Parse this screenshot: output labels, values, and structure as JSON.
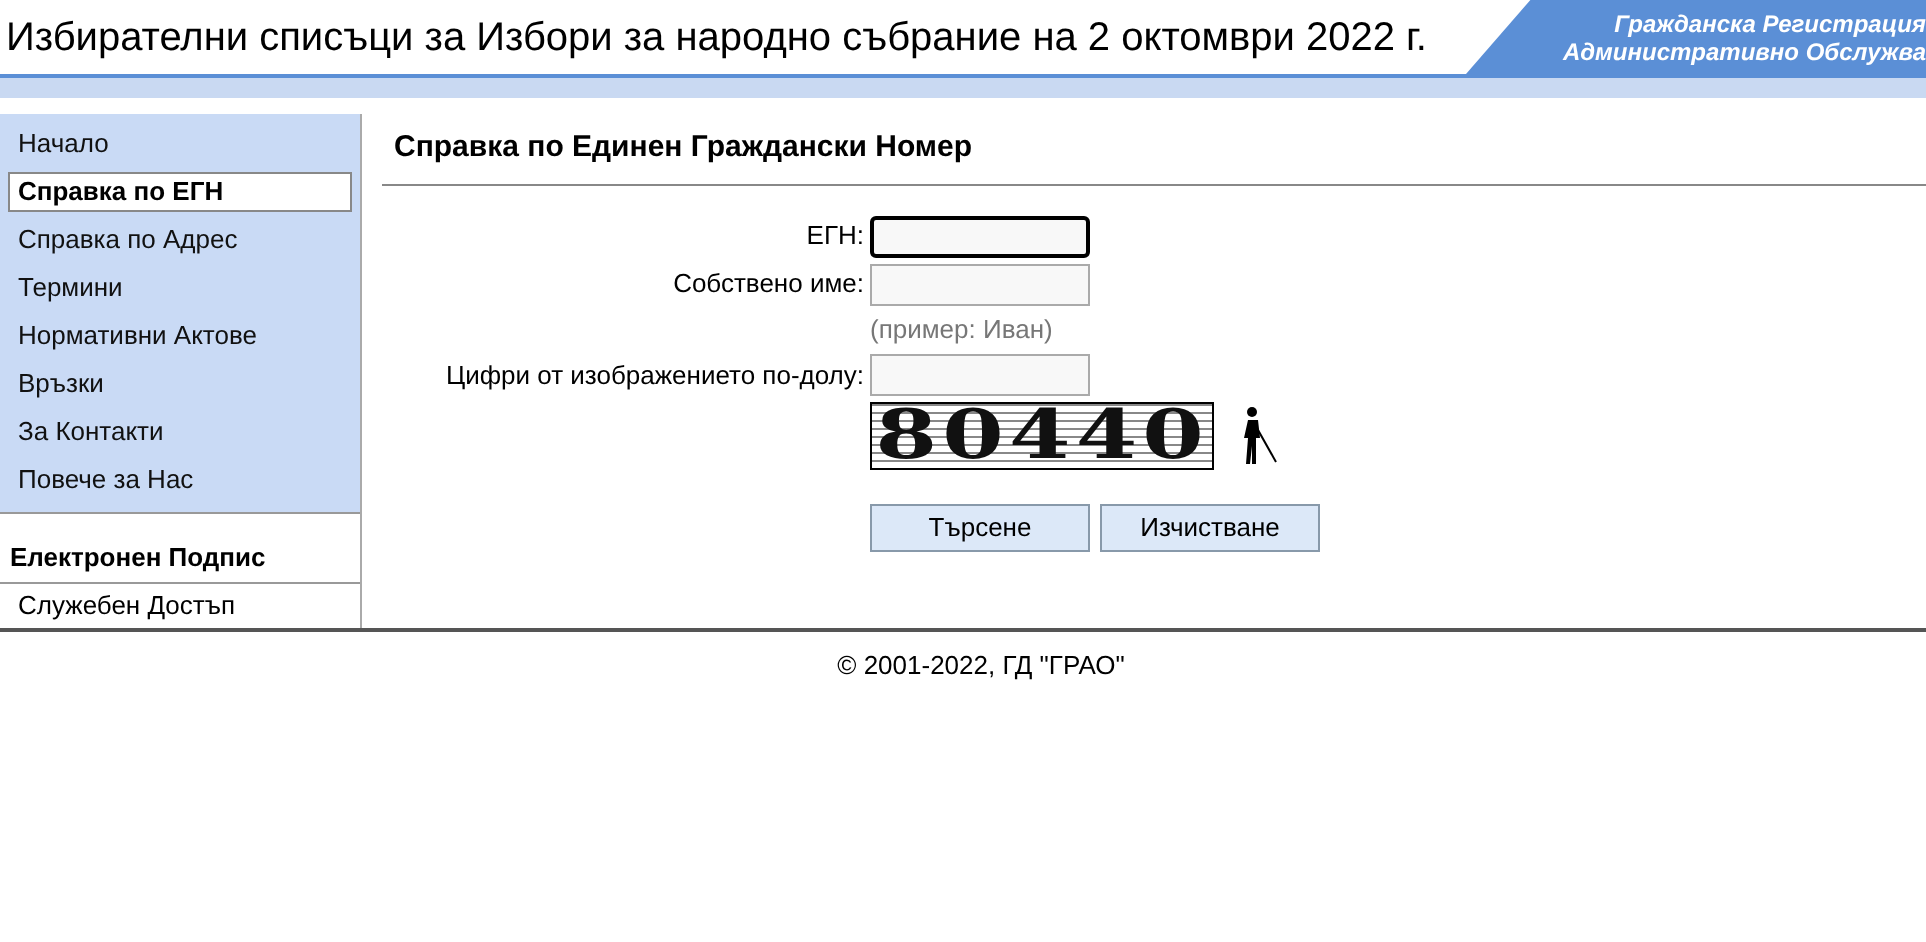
{
  "header": {
    "title": "Избирателни списъци за Избори за народно събрание на 2 октомври 2022 г.",
    "banner_lines": [
      "Гражданска Регистрация",
      "Административно Обслужва"
    ]
  },
  "sidebar": {
    "items": [
      {
        "label": "Начало",
        "selected": false
      },
      {
        "label": "Справка по ЕГН",
        "selected": true
      },
      {
        "label": "Справка по Адрес",
        "selected": false
      },
      {
        "label": "Термини",
        "selected": false
      },
      {
        "label": "Нормативни Актове",
        "selected": false
      },
      {
        "label": "Връзки",
        "selected": false
      },
      {
        "label": "За Контакти",
        "selected": false
      },
      {
        "label": "Повече за Нас",
        "selected": false
      }
    ],
    "section_title": "Електронен Подпис",
    "section_items": [
      "Служебен Достъп"
    ]
  },
  "form": {
    "title": "Справка по Единен Граждански Номер",
    "fields": [
      {
        "label": "ЕГН:",
        "focused": true
      },
      {
        "label": "Собствено име:",
        "focused": false,
        "hint": "(пример: Иван)"
      },
      {
        "label": "Цифри от изображението по-долу:",
        "focused": false
      }
    ],
    "captcha": "80440",
    "buttons": [
      "Търсене",
      "Изчистване"
    ]
  },
  "footer": "© 2001-2022, ГД \"ГРАО\""
}
